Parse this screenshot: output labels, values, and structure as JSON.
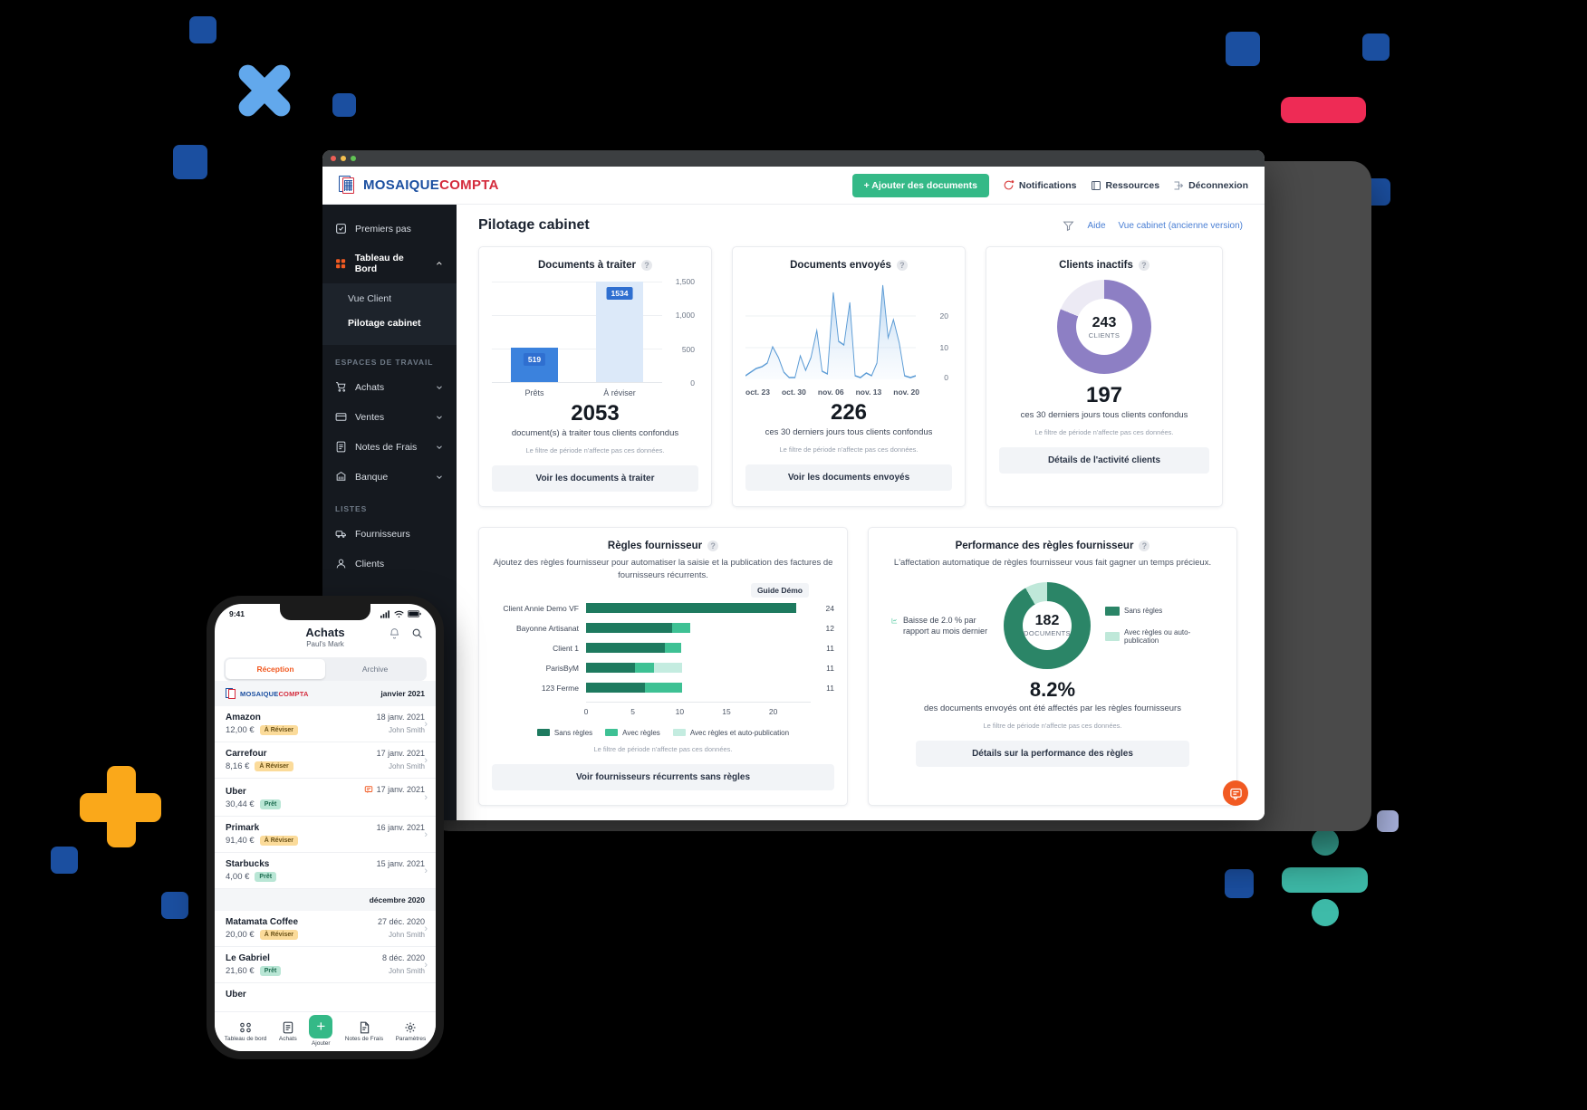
{
  "background": {
    "color": "#000000"
  },
  "decor": {
    "squares_dark_blue": "#1B4FA0",
    "square_light": "#AAB4E0",
    "x_color": "#62A8EC",
    "plus_color": "#FAA81A",
    "pill_pink": "#EE2B55",
    "divide_teal": "#3EBBA9"
  },
  "browser": {
    "traffic_lights": [
      "close-red",
      "minimize-yellow",
      "maximize-green"
    ],
    "logo": {
      "first": "MOSAIQUE",
      "second": "COMPTA"
    },
    "topnav": {
      "add_documents": "+ Ajouter des documents",
      "notifications": "Notifications",
      "resources": "Ressources",
      "logout": "Déconnexion"
    }
  },
  "sidebar": {
    "items": [
      {
        "label": "Premiers pas",
        "icon": "check-square-icon",
        "type": "item"
      },
      {
        "label": "Tableau de Bord",
        "icon": "dashboard-icon",
        "type": "expanded"
      }
    ],
    "dashboard_children": [
      {
        "label": "Vue Client",
        "active": false
      },
      {
        "label": "Pilotage cabinet",
        "active": true
      }
    ],
    "workspaces_header": "ESPACES DE TRAVAIL",
    "workspaces": [
      {
        "label": "Achats",
        "icon": "cart-icon"
      },
      {
        "label": "Ventes",
        "icon": "card-icon"
      },
      {
        "label": "Notes de Frais",
        "icon": "receipt-icon"
      },
      {
        "label": "Banque",
        "icon": "bank-icon"
      }
    ],
    "lists_header": "LISTES",
    "lists": [
      {
        "label": "Fournisseurs",
        "icon": "truck-icon"
      },
      {
        "label": "Clients",
        "icon": "user-icon"
      }
    ]
  },
  "main": {
    "page_title": "Pilotage cabinet",
    "filter_icon": "filter-icon",
    "help_link": "Aide",
    "old_view_link": "Vue cabinet (ancienne version)",
    "period_note": "Le filtre de période n'affecte pas ces données."
  },
  "cards": {
    "docs_to_process": {
      "title": "Documents à traiter",
      "big_number": "2053",
      "caption": "document(s) à traiter tous clients confondus",
      "cta": "Voir les documents à traiter"
    },
    "docs_sent": {
      "title": "Documents envoyés",
      "big_number": "226",
      "caption": "ces 30 derniers jours tous clients confondus",
      "cta": "Voir les documents envoyés"
    },
    "inactive_clients": {
      "title": "Clients inactifs",
      "donut_number": "243",
      "donut_caption": "CLIENTS",
      "big_number": "197",
      "caption": "ces 30 derniers jours tous clients confondus",
      "cta": "Détails de l'activité clients"
    },
    "supplier_rules": {
      "title": "Règles fournisseur",
      "description": "Ajoutez des règles fournisseur pour automatiser la saisie et la publication des factures de fournisseurs récurrents.",
      "guide_badge": "Guide Démo",
      "cta": "Voir fournisseurs récurrents sans règles"
    },
    "rules_performance": {
      "title": "Performance des règles fournisseur",
      "description": "L'affectation automatique de règles fournisseur vous fait gagner un temps précieux.",
      "trend_note": "Baisse de 2.0 % par rapport au mois dernier",
      "trend_icon": "trend-chart-icon",
      "donut_number": "182",
      "donut_caption": "DOCUMENTS",
      "percent": "8.2%",
      "caption": "des documents envoyés ont été affectés par les règles fournisseurs",
      "cta": "Détails sur la performance des règles"
    },
    "chat_fab": "chat-bubble-icon"
  },
  "chart_data": [
    {
      "type": "bar",
      "title": "Documents à traiter",
      "categories": [
        "Prêts",
        "À réviser"
      ],
      "values": [
        519,
        1534
      ],
      "data_labels": [
        "519",
        "1534"
      ],
      "colors": [
        "#3b82dd",
        "#dce9f9"
      ],
      "ylim": [
        0,
        1500
      ],
      "yticks": [
        0,
        500,
        1000,
        1500
      ],
      "ytick_labels": [
        "0",
        "500",
        "1,000",
        "1,500"
      ],
      "grid": true,
      "xlabel": "",
      "ylabel": ""
    },
    {
      "type": "area",
      "title": "Documents envoyés",
      "xlabel": "",
      "ylabel": "",
      "ylim": [
        0,
        27
      ],
      "yticks": [
        0,
        10,
        20
      ],
      "ytick_labels": [
        "0",
        "10",
        "20"
      ],
      "xtick_labels": [
        "oct. 23",
        "oct. 30",
        "nov. 06",
        "nov. 13",
        "nov. 20"
      ],
      "line_color": "#5b9bd5",
      "values": [
        1,
        2,
        3,
        3.5,
        4,
        8,
        5,
        2,
        0.5,
        0.5,
        6,
        2,
        5.5,
        14,
        2,
        1.5,
        24,
        10,
        9.5,
        21,
        1,
        0.5,
        1.5,
        1,
        4,
        27,
        12,
        17,
        10,
        1,
        0.5,
        1
      ]
    },
    {
      "type": "pie",
      "title": "Clients inactifs",
      "center_value": "243",
      "center_label": "CLIENTS",
      "slices": [
        {
          "name": "Inactifs",
          "value": 81,
          "color": "#8d7fc4"
        },
        {
          "name": "Actifs",
          "value": 19,
          "color": "#eceaf4"
        }
      ]
    },
    {
      "type": "bar",
      "orientation": "horizontal",
      "stacked": true,
      "title": "Règles fournisseur",
      "categories": [
        "Client Annie Demo VF",
        "Bayonne Artisanat",
        "Client 1",
        "ParisByM",
        "123 Ferme"
      ],
      "totals": [
        24,
        12,
        11,
        11,
        11
      ],
      "xlim": [
        0,
        24
      ],
      "xticks": [
        0,
        5,
        10,
        15,
        20
      ],
      "xtick_labels": [
        "0",
        "5",
        "10",
        "15",
        "20"
      ],
      "series": [
        {
          "name": "Sans règles",
          "color": "#1e7a5f",
          "values": [
            23.5,
            9.6,
            8.8,
            5.5,
            6.6
          ]
        },
        {
          "name": "Avec règles",
          "color": "#3ec194",
          "values": [
            0,
            2.0,
            1.9,
            2.1,
            4.1
          ]
        },
        {
          "name": "Avec règles et auto-publication",
          "color": "#c4ece0",
          "values": [
            0,
            0,
            0,
            3.1,
            0
          ]
        }
      ],
      "legend_position": "bottom"
    },
    {
      "type": "pie",
      "title": "Performance des règles fournisseur",
      "center_value": "182",
      "center_label": "DOCUMENTS",
      "slices": [
        {
          "name": "Sans règles",
          "value": 91.8,
          "color": "#2b8567"
        },
        {
          "name": "Avec règles ou auto-publication",
          "value": 8.2,
          "color": "#bfe8d9"
        }
      ],
      "legend_position": "right"
    }
  ],
  "phone": {
    "status": {
      "time": "9:41",
      "signal": "signal-icon",
      "wifi": "wifi-icon",
      "battery": "battery-icon"
    },
    "title": "Achats",
    "subtitle": "Paul's Mark",
    "bell_icon": "bell-icon",
    "search_icon": "search-icon",
    "tabs": [
      {
        "label": "Réception",
        "active": true
      },
      {
        "label": "Archive",
        "active": false
      }
    ],
    "month_headers": {
      "first": "janvier 2021",
      "second": "décembre 2020"
    },
    "brand": {
      "first": "MOSAIQUE",
      "second": "COMPTA"
    },
    "transactions_january": [
      {
        "name": "Amazon",
        "amount": "12,00 €",
        "status": "À Réviser",
        "status_type": "review",
        "date": "18 janv. 2021",
        "user": "John Smith",
        "comment": false
      },
      {
        "name": "Carrefour",
        "amount": "8,16 €",
        "status": "À Réviser",
        "status_type": "review",
        "date": "17 janv. 2021",
        "user": "John Smith",
        "comment": false
      },
      {
        "name": "Uber",
        "amount": "30,44 €",
        "status": "Prêt",
        "status_type": "ready",
        "date": "17 janv. 2021",
        "user": "",
        "comment": true
      },
      {
        "name": "Primark",
        "amount": "91,40 €",
        "status": "À Réviser",
        "status_type": "review",
        "date": "16 janv. 2021",
        "user": "",
        "comment": false
      },
      {
        "name": "Starbucks",
        "amount": "4,00 €",
        "status": "Prêt",
        "status_type": "ready",
        "date": "15 janv. 2021",
        "user": "",
        "comment": false
      }
    ],
    "transactions_december": [
      {
        "name": "Matamata Coffee",
        "amount": "20,00 €",
        "status": "À Réviser",
        "status_type": "review",
        "date": "27 déc. 2020",
        "user": "John Smith",
        "comment": false
      },
      {
        "name": "Le Gabriel",
        "amount": "21,60 €",
        "status": "Prêt",
        "status_type": "ready",
        "date": "8 déc. 2020",
        "user": "John Smith",
        "comment": false
      },
      {
        "name": "Uber",
        "amount": "",
        "status": "",
        "status_type": "",
        "date": "",
        "user": "",
        "comment": false
      }
    ],
    "tabbar": [
      {
        "label": "Tableau de bord",
        "icon": "dashboard-icon"
      },
      {
        "label": "Achats",
        "icon": "receipt-icon"
      },
      {
        "label": "Ajouter",
        "icon": "plus-icon"
      },
      {
        "label": "Notes de Frais",
        "icon": "note-icon"
      },
      {
        "label": "Paramètres",
        "icon": "gear-icon"
      }
    ]
  }
}
